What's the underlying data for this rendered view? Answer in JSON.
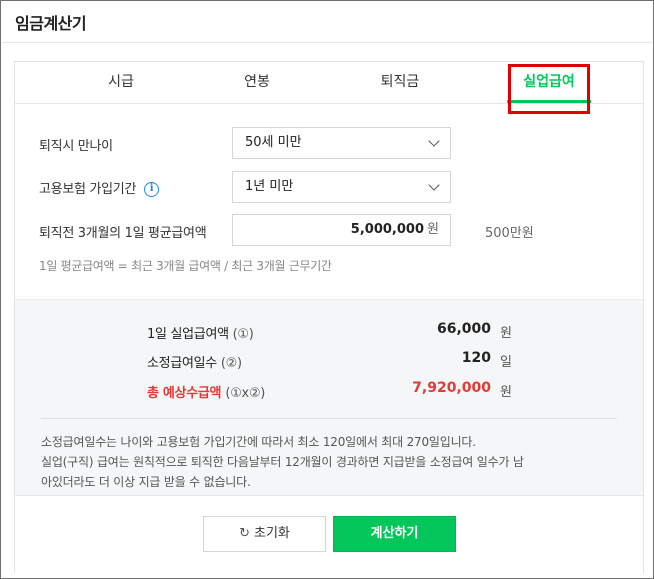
{
  "widget": {
    "title": "임금계산기"
  },
  "tabs": [
    {
      "label": "시급",
      "active": false
    },
    {
      "label": "연봉",
      "active": false
    },
    {
      "label": "퇴직금",
      "active": false
    },
    {
      "label": "실업급여",
      "active": true
    }
  ],
  "form": {
    "age": {
      "label": "퇴직시 만나이",
      "value": "50세 미만"
    },
    "insurance_period": {
      "label": "고용보험 가입기간",
      "info_icon": "i",
      "value": "1년 미만"
    },
    "avg_wage": {
      "label": "퇴직전 3개월의 1일 평균급여액",
      "value": "5,000,000",
      "unit": "원",
      "hint": "500만원"
    },
    "formula": "1일 평균급여액 = 최근 3개월 급여액 / 최근 3개월 근무기간"
  },
  "results": {
    "daily_benefit": {
      "label": "1일 실업급여액",
      "symbol": "(①)",
      "value": "66,000",
      "unit": "원"
    },
    "benefit_days": {
      "label": "소정급여일수",
      "symbol": "(②)",
      "value": "120",
      "unit": "일"
    },
    "total": {
      "label": "총 예상수급액",
      "symbol": "(①x②)",
      "value": "7,920,000",
      "unit": "원"
    },
    "notes": [
      "소정급여일수는 나이와 고용보험 가입기간에 따라서 최소 120일에서 최대 270일입니다.",
      "실업(구직) 급여는 원칙적으로 퇴직한 다음날부터 12개월이 경과하면 지급받을 소정급여 일수가 남",
      "아있더라도 더 이상 지급 받을 수 없습니다."
    ]
  },
  "buttons": {
    "reset": "초기화",
    "reset_icon": "↻",
    "calculate": "계산하기"
  },
  "colors": {
    "accent": "#03c75a",
    "total": "#e53935",
    "highlight": "#e00000",
    "info": "#1e88e5"
  }
}
